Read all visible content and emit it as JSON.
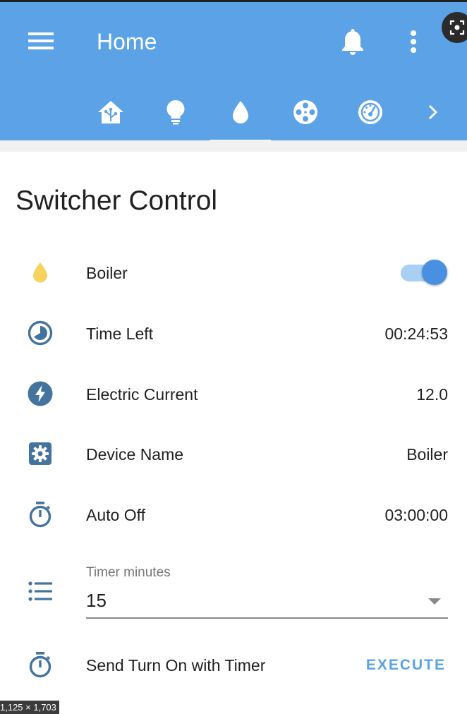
{
  "header": {
    "title": "Home",
    "icons": {
      "menu": "hamburger-menu-icon",
      "bell": "bell-icon",
      "more": "more-vert-icon",
      "lens": "image-search-icon"
    }
  },
  "tabs": [
    {
      "icon": "home-assistant-icon",
      "active": false
    },
    {
      "icon": "lightbulb-icon",
      "active": false
    },
    {
      "icon": "water-drop-icon",
      "active": true
    },
    {
      "icon": "film-reel-icon",
      "active": false
    },
    {
      "icon": "gauge-icon",
      "active": false
    },
    {
      "icon": "chevron-right-icon",
      "active": false
    }
  ],
  "card": {
    "title": "Switcher Control",
    "rows": [
      {
        "icon": "water-drop-icon",
        "label": "Boiler",
        "toggle_on": true
      },
      {
        "icon": "timer-clock-icon",
        "label": "Time Left",
        "value": "00:24:53"
      },
      {
        "icon": "flash-icon",
        "label": "Electric Current",
        "value": "12.0"
      },
      {
        "icon": "settings-box-icon",
        "label": "Device Name",
        "value": "Boiler"
      },
      {
        "icon": "timer-outline-icon",
        "label": "Auto Off",
        "value": "03:00:00"
      }
    ],
    "select": {
      "icon": "format-list-icon",
      "label": "Timer minutes",
      "value": "15"
    },
    "action": {
      "icon": "timer-outline-icon",
      "label": "Send Turn On with Timer",
      "button": "EXECUTE"
    }
  },
  "colors": {
    "header": "#5ba2e6",
    "icon": "#44739e",
    "boiler_drop": "#f5d35c",
    "toggle_knob": "#4a90e2",
    "toggle_track": "#a9cff4",
    "execute": "#5ba2e6"
  },
  "badge": "1,125 × 1,703"
}
